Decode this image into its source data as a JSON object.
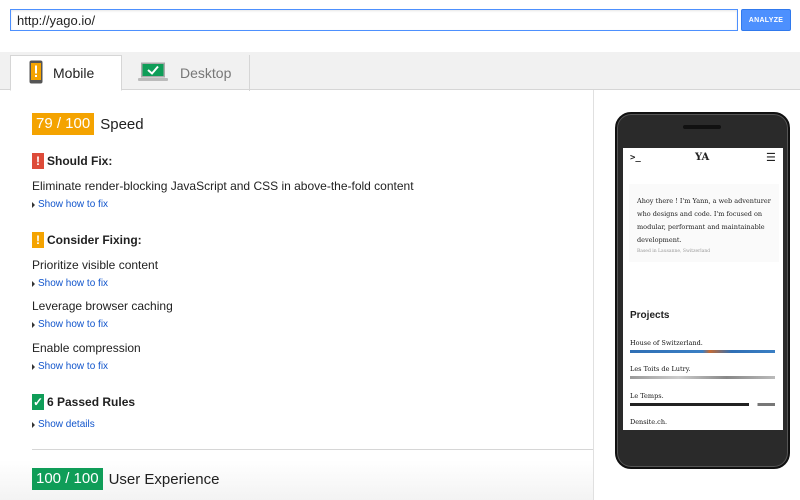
{
  "search": {
    "url": "http://yago.io/",
    "analyze_label": "ANALYZE"
  },
  "tabs": [
    {
      "label": "Mobile",
      "active": true,
      "icon": "mobile-warning-icon"
    },
    {
      "label": "Desktop",
      "active": false,
      "icon": "desktop-check-icon"
    }
  ],
  "speed": {
    "score": "79 / 100",
    "label": "Speed",
    "color": "#f4a300"
  },
  "should_fix": {
    "title": "Should Fix:",
    "icon": "!",
    "color": "#dd4b39",
    "rules": [
      {
        "text": "Eliminate render-blocking JavaScript and CSS in above-the-fold content",
        "link": "Show how to fix"
      }
    ]
  },
  "consider_fixing": {
    "title": "Consider Fixing:",
    "icon": "!",
    "color": "#f4a300",
    "rules": [
      {
        "text": "Prioritize visible content",
        "link": "Show how to fix"
      },
      {
        "text": "Leverage browser caching",
        "link": "Show how to fix"
      },
      {
        "text": "Enable compression",
        "link": "Show how to fix"
      }
    ]
  },
  "passed": {
    "title": "6 Passed Rules",
    "icon": "✓",
    "color": "#0f9d58",
    "link": "Show details"
  },
  "user_experience": {
    "score": "100 / 100",
    "label": "User Experience",
    "color": "#0f9d58"
  },
  "phone_preview": {
    "prompt": ">_",
    "logo": "YA",
    "menu": "☰",
    "intro": "Ahoy there ! I'm Yann, a web adventurer who designs and code. I'm focused on modular, performant and maintainable development.",
    "location": "Based in Lausanne, Switzerland",
    "projects_title": "Projects",
    "projects": [
      "House of Switzerland.",
      "Les Toits de Lutry.",
      "Le Temps.",
      "Densite.ch."
    ]
  }
}
